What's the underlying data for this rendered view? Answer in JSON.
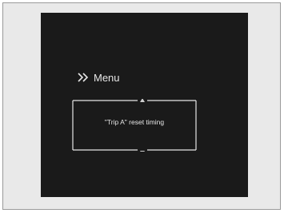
{
  "display": {
    "menu_label": "Menu",
    "item_label": "\"Trip A\" reset timing"
  },
  "icons": {
    "menu": "double-chevron-right-icon",
    "up": "arrow-up-icon",
    "down": "arrow-down-icon"
  },
  "colors": {
    "screen_bg": "#1a1a1a",
    "frame_bg": "#e9e9e9",
    "text": "#e6e6e6"
  }
}
